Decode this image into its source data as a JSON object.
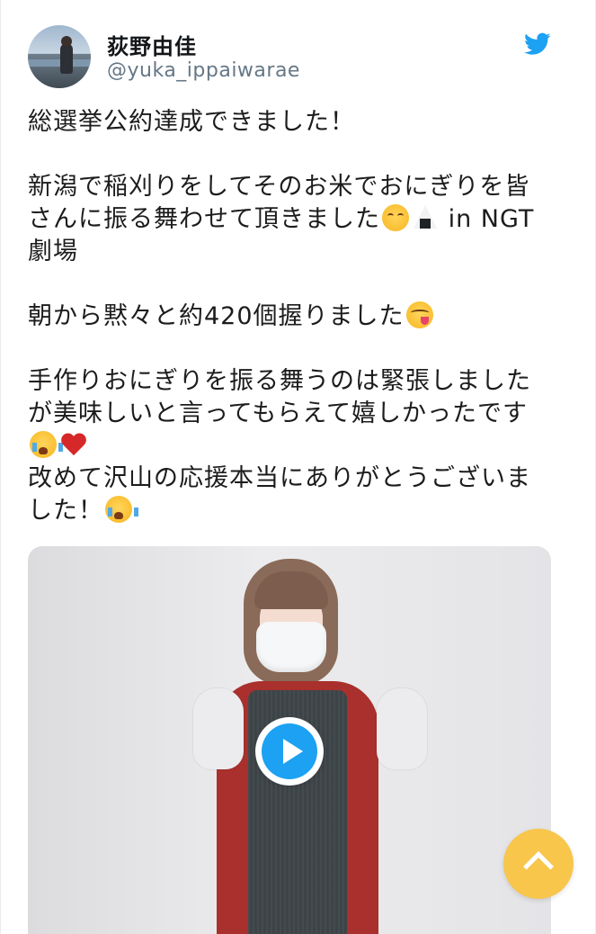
{
  "tweet": {
    "author_name": "荻野由佳",
    "author_handle": "@yuka_ippaiwarae",
    "lines": [
      "総選挙公約達成できました！",
      "新潟で稲刈りをしてそのお米でおにぎりを皆",
      "さんに振る舞わせて頂きました",
      " in NGT",
      "劇場",
      "朝から黙々と約420個握りました",
      "手作りおにぎりを振る舞うのは緊張しました",
      "が美味しいと言ってもらえて嬉しかったです",
      "改めて沢山の応援本当にありがとうございま",
      "した！"
    ]
  },
  "icons": {
    "brand": "twitter-bird-icon",
    "play": "play-icon",
    "scroll": "chevron-up-icon"
  },
  "colors": {
    "twitter_blue": "#1da1f2",
    "scroll_button": "#f7c64b",
    "handle_gray": "#657786"
  }
}
